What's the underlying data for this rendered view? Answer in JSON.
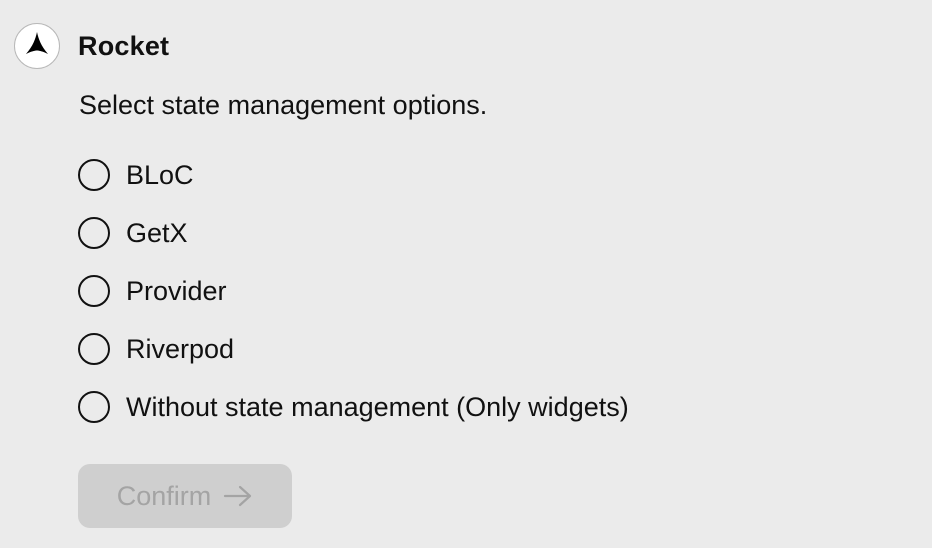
{
  "app": {
    "name": "Rocket",
    "icon": "rocket-logo-icon"
  },
  "question": {
    "prompt": "Select state management options."
  },
  "options": [
    {
      "label": "BLoC",
      "selected": false
    },
    {
      "label": "GetX",
      "selected": false
    },
    {
      "label": "Provider",
      "selected": false
    },
    {
      "label": "Riverpod",
      "selected": false
    },
    {
      "label": "Without state management (Only widgets)",
      "selected": false
    }
  ],
  "confirm": {
    "label": "Confirm",
    "icon": "arrow-right-icon",
    "enabled": false
  },
  "colors": {
    "background": "#ebebeb",
    "text": "#111111",
    "button_disabled_bg": "#cfcfcf",
    "button_disabled_text": "#a4a4a4"
  }
}
